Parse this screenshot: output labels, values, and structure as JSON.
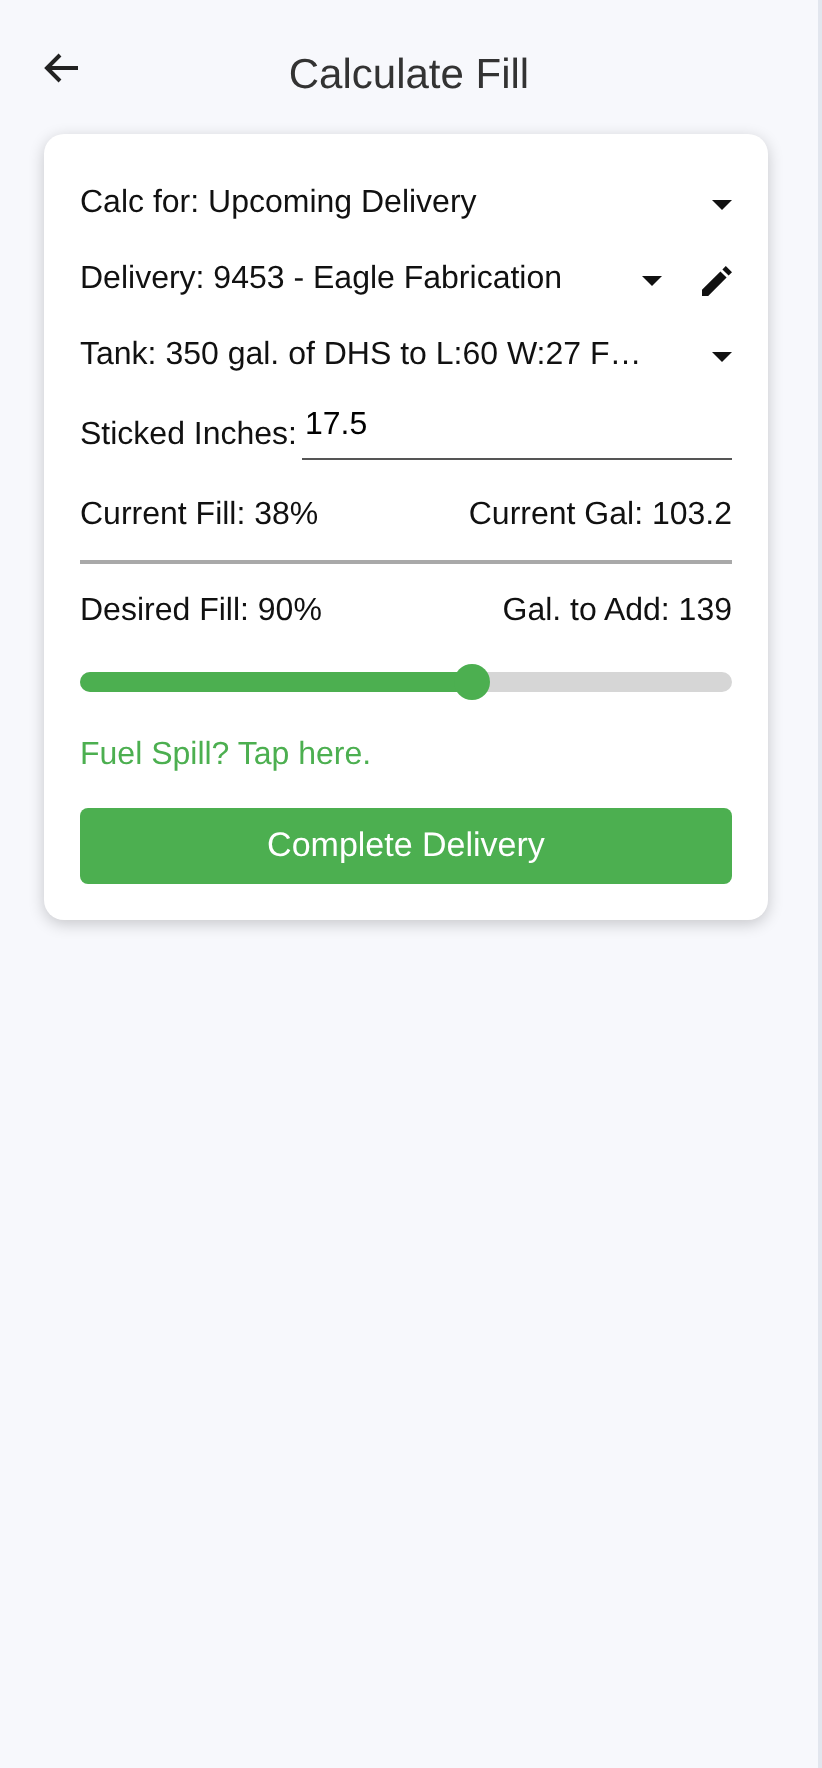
{
  "header": {
    "title": "Calculate Fill"
  },
  "selects": [
    {
      "value": "Calc for: Upcoming Delivery",
      "editable": false
    },
    {
      "value": "Delivery: 9453 - Eagle Fabrication",
      "editable": true
    },
    {
      "value": "Tank: 350 gal. of DHS to L:60 W:27 F…",
      "editable": false
    }
  ],
  "sticked": {
    "label": "Sticked Inches:",
    "value": "17.5"
  },
  "current": {
    "fill": "Current Fill: 38%",
    "gallons": "Current Gal: 103.2"
  },
  "desired": {
    "fill": "Desired Fill: 90%",
    "gallons": "Gal. to Add: 139"
  },
  "slider": {
    "level": 0.6
  },
  "spill_link": "Fuel Spill? Tap here.",
  "primary_button": "Complete Delivery"
}
